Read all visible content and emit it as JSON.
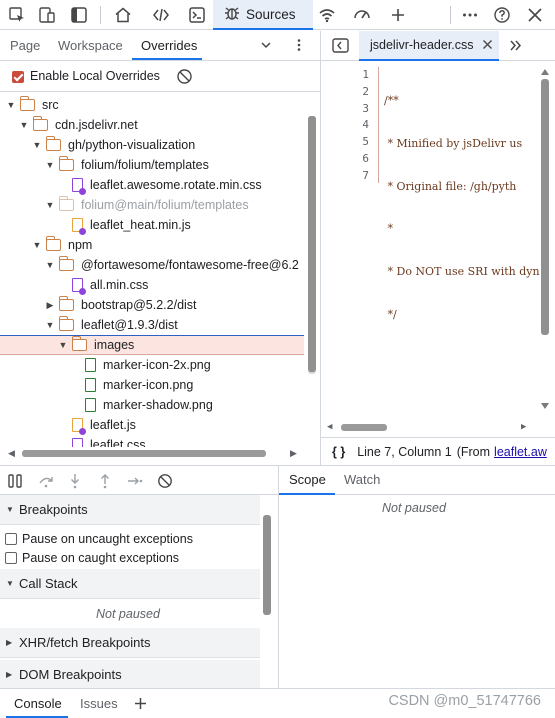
{
  "toolbar": {
    "sources_label": "Sources",
    "icons": [
      "inspect-icon",
      "device-icon",
      "dock-icon",
      "home-icon",
      "elements-icon",
      "console-icon",
      "sources-icon",
      "network-icon",
      "performance-icon",
      "add-icon",
      "more-icon",
      "help-icon",
      "close-icon"
    ]
  },
  "navigator": {
    "tabs": [
      "Page",
      "Workspace",
      "Overrides"
    ],
    "active_tab": "Overrides",
    "enable_overrides_label": "Enable Local Overrides",
    "tree": [
      {
        "label": "src",
        "type": "folder",
        "depth": 0,
        "expanded": true
      },
      {
        "label": "cdn.jsdelivr.net",
        "type": "folder",
        "depth": 1,
        "expanded": true
      },
      {
        "label": "gh/python-visualization",
        "type": "folder",
        "depth": 2,
        "expanded": true
      },
      {
        "label": "folium/folium/templates",
        "type": "folder",
        "depth": 3,
        "expanded": true
      },
      {
        "label": "leaflet.awesome.rotate.min.css",
        "type": "file-css",
        "depth": 4
      },
      {
        "label": "folium@main/folium/templates",
        "type": "folder-dim",
        "depth": 3,
        "expanded": true
      },
      {
        "label": "leaflet_heat.min.js",
        "type": "file-js",
        "depth": 4
      },
      {
        "label": "npm",
        "type": "folder",
        "depth": 2,
        "expanded": true
      },
      {
        "label": "@fortawesome/fontawesome-free@6.2",
        "type": "folder",
        "depth": 3,
        "expanded": true
      },
      {
        "label": "all.min.css",
        "type": "file-css",
        "depth": 4
      },
      {
        "label": "bootstrap@5.2.2/dist",
        "type": "folder",
        "depth": 3,
        "expanded": false
      },
      {
        "label": "leaflet@1.9.3/dist",
        "type": "folder",
        "depth": 3,
        "expanded": true
      },
      {
        "label": "images",
        "type": "folder",
        "depth": 4,
        "expanded": true,
        "selected": true
      },
      {
        "label": "marker-icon-2x.png",
        "type": "file-img",
        "depth": 5
      },
      {
        "label": "marker-icon.png",
        "type": "file-img",
        "depth": 5
      },
      {
        "label": "marker-shadow.png",
        "type": "file-img",
        "depth": 5
      },
      {
        "label": "leaflet.js",
        "type": "file-js",
        "depth": 4
      },
      {
        "label": "leaflet.css",
        "type": "file-css",
        "depth": 4
      }
    ]
  },
  "editor": {
    "tab_label": "jsdelivr-header.css",
    "line_numbers": [
      "1",
      "2",
      "3",
      "4",
      "5",
      "6",
      "7"
    ],
    "lines": [
      "/**",
      " * Minified by jsDelivr us",
      " * Original file: /gh/pyth",
      " *",
      " * Do NOT use SRI with dyn",
      " */",
      ""
    ],
    "status_braces": "{ }",
    "status_text": "Line 7, Column 1",
    "status_from": "(From",
    "status_link": "leaflet.aw"
  },
  "debugger": {
    "sections": {
      "breakpoints": "Breakpoints",
      "pause_uncaught": "Pause on uncaught exceptions",
      "pause_caught": "Pause on caught exceptions",
      "call_stack": "Call Stack",
      "call_stack_status": "Not paused",
      "xhr": "XHR/fetch Breakpoints",
      "dom": "DOM Breakpoints"
    },
    "scope_tabs": [
      "Scope",
      "Watch"
    ],
    "scope_status": "Not paused"
  },
  "drawer": {
    "tabs": [
      "Console",
      "Issues"
    ],
    "watermark": "CSDN @m0_51747766"
  }
}
